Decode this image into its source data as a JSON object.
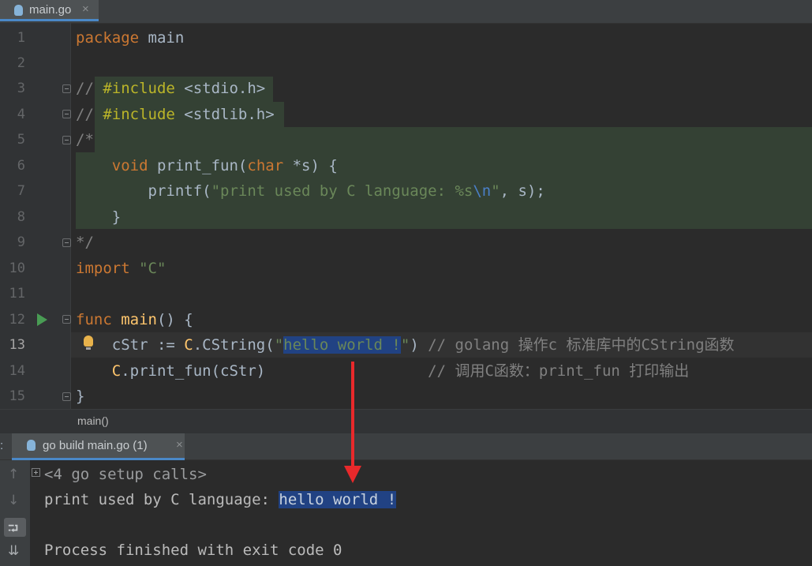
{
  "tab": {
    "label": "main.go",
    "close": "×",
    "icon": "gopher-file-icon"
  },
  "editor": {
    "line_numbers": [
      "1",
      "2",
      "3",
      "4",
      "5",
      "6",
      "7",
      "8",
      "9",
      "10",
      "11",
      "12",
      "13",
      "14",
      "15"
    ],
    "current_line": "13",
    "lines": {
      "l1_kw": "package",
      "l1_rest": " main",
      "l3_a": "// ",
      "l3_b": "#include",
      "l3_c": " <stdio.h>",
      "l4_a": "// ",
      "l4_b": "#include",
      "l4_c": " <stdlib.h>",
      "l5": "/*",
      "l6_a": "    ",
      "l6_kw1": "void",
      "l6_b": " print_fun(",
      "l6_kw2": "char",
      "l6_c": " *s) {",
      "l7_a": "        printf(",
      "l7_q": "\"print used by C language: %s",
      "l7_esc": "\\n",
      "l7_q2": "\"",
      "l7_b": ", s);",
      "l8": "    }",
      "l9": "*/",
      "l10_kw": "import",
      "l10_str": " \"C\"",
      "l12_kw": "func",
      "l12_fn": " main",
      "l12_rest": "() {",
      "l13_a": "    cStr := ",
      "l13_c": "C",
      "l13_b": ".CString(",
      "l13_q1": "\"",
      "l13_sel": "hello world !",
      "l13_q2": "\"",
      "l13_close": ")",
      "l13_cmt": " // golang 操作c 标准库中的CString函数",
      "l14_c": "    C",
      "l14_a": ".print_fun(cStr)",
      "l14_cmt": "                  // 调用C函数：print_fun 打印输出",
      "l15": "}"
    }
  },
  "breadcrumb": "main()",
  "run_window": {
    "prefix": ":",
    "tab_label": "go build main.go (1)",
    "tab_close": "×",
    "output": {
      "setup_calls": "<4 go setup calls>",
      "line1_a": "print used by C language: ",
      "line1_sel": "hello world !",
      "line3": "Process finished with exit code 0"
    },
    "side_icons": [
      "up-arrow-icon",
      "down-arrow-icon",
      "soft-wrap-icon",
      "scroll-to-end-icon"
    ],
    "side_glyphs": [
      "↑",
      "↓",
      "⮒",
      "⇊"
    ]
  },
  "colors": {
    "selection": "#214283",
    "comment_block": "#344134",
    "arrow": "#e8292b",
    "run_green": "#499c54"
  }
}
